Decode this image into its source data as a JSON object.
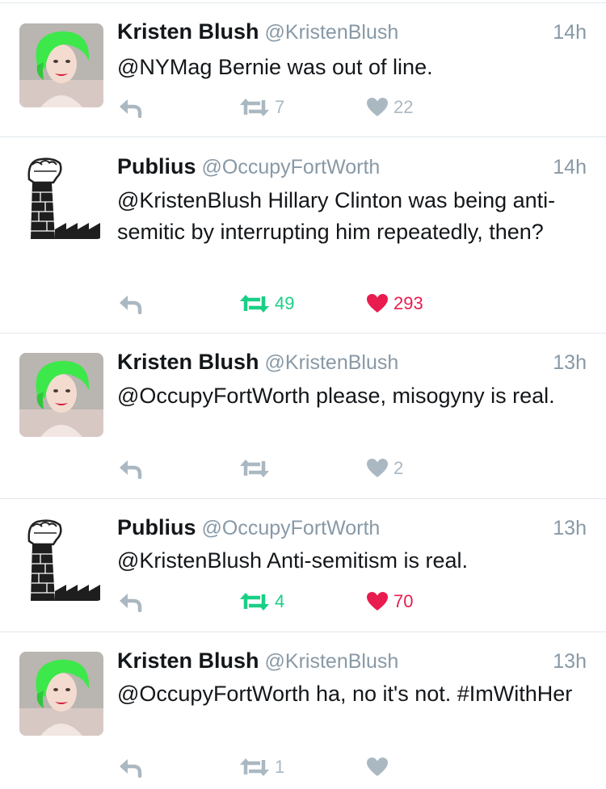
{
  "colors": {
    "retweet_active": "#19cf86",
    "like_active": "#e81c4f",
    "inactive": "#aab8c2",
    "secondary_text": "#8899a6",
    "primary_text": "#14171a"
  },
  "tweets": [
    {
      "name": "Kristen Blush",
      "handle": "@KristenBlush",
      "time": "14h",
      "text": "@NYMag Bernie was out of line.",
      "retweets": "7",
      "likes": "22",
      "retweet_active": false,
      "like_active": false,
      "avatar": "green-hair-woman-avatar"
    },
    {
      "name": "Publius",
      "handle": "@OccupyFortWorth",
      "time": "14h",
      "text": "@KristenBlush Hillary Clinton was being anti-semitic by interrupting him repeatedly, then?",
      "retweets": "49",
      "likes": "293",
      "retweet_active": true,
      "like_active": true,
      "avatar": "fist-factory-avatar"
    },
    {
      "name": "Kristen Blush",
      "handle": "@KristenBlush",
      "time": "13h",
      "text": "@OccupyFortWorth please, misogyny is real.",
      "retweets": "",
      "likes": "2",
      "retweet_active": false,
      "like_active": false,
      "avatar": "green-hair-woman-avatar"
    },
    {
      "name": "Publius",
      "handle": "@OccupyFortWorth",
      "time": "13h",
      "text": "@KristenBlush Anti-semitism is real.",
      "retweets": "4",
      "likes": "70",
      "retweet_active": true,
      "like_active": true,
      "avatar": "fist-factory-avatar"
    },
    {
      "name": "Kristen Blush",
      "handle": "@KristenBlush",
      "time": "13h",
      "text": "@OccupyFortWorth ha, no it's not. #ImWithHer",
      "retweets": "1",
      "likes": "",
      "retweet_active": false,
      "like_active": false,
      "avatar": "green-hair-woman-avatar"
    }
  ]
}
